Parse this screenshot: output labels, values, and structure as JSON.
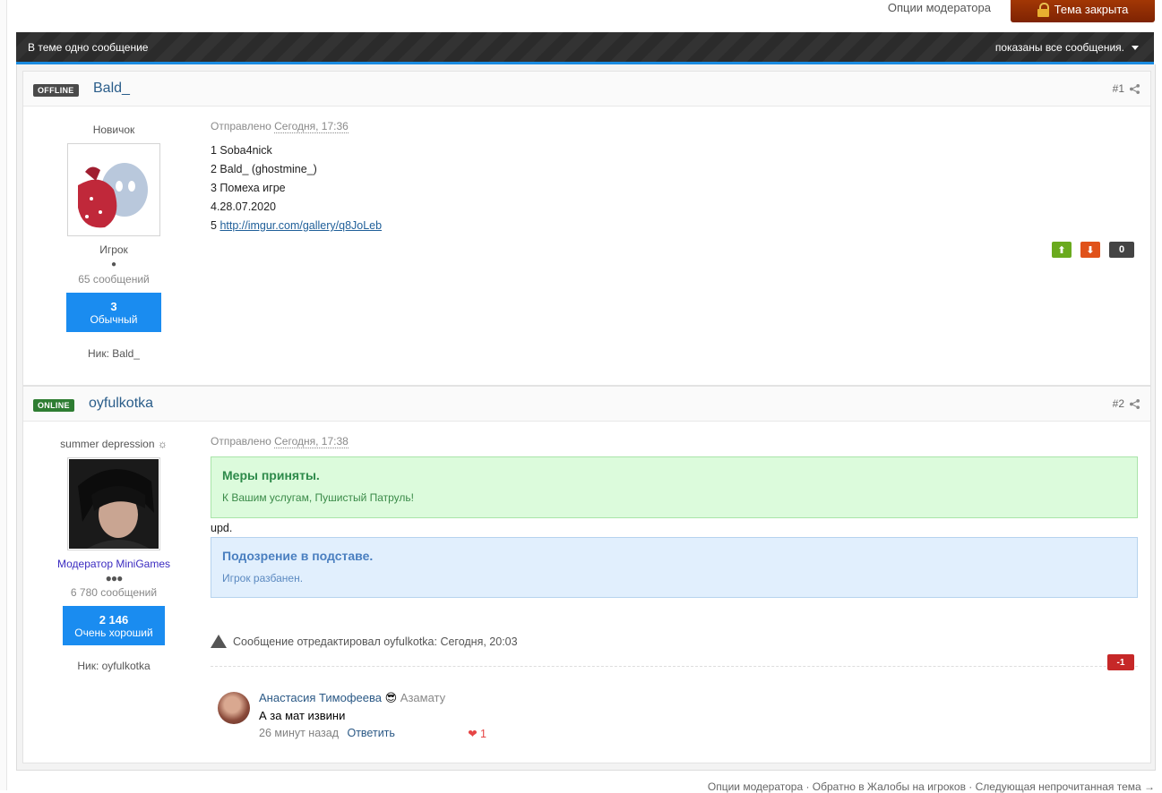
{
  "topbar": {
    "mod_options": "Опции модератора",
    "topic_closed": "Тема закрыта"
  },
  "thread_header": {
    "left": "В теме одно сообщение",
    "right": "показаны все сообщения."
  },
  "posts": [
    {
      "status": "OFFLINE",
      "username": "Bald_",
      "number": "#1",
      "user_title": "Новичок",
      "group": "Игрок",
      "post_count": "65 сообщений",
      "rep_value": "3",
      "rep_label": "Обычный",
      "nick": "Ник: Bald_",
      "sent_prefix": "Отправлено",
      "sent_time": "Сегодня, 17:36",
      "lines": [
        "1 Soba4nick",
        "2 Bald_ (ghostmine_)",
        "3 Помеха игре",
        "4.28.07.2020"
      ],
      "line5_prefix": "5 ",
      "line5_link": "http://imgur.com/gallery/q8JoLeb",
      "vote_count": "0"
    },
    {
      "status": "ONLINE",
      "username": "oyfulkotka",
      "number": "#2",
      "user_title": "summer depression ☼",
      "group": "Модератор MiniGames",
      "post_count": "6 780 сообщений",
      "rep_value": "2 146",
      "rep_label": "Очень хороший",
      "nick": "Ник: oyfulkotka",
      "sent_prefix": "Отправлено",
      "sent_time": "Сегодня, 17:38",
      "green_title": "Меры приняты.",
      "green_sub": "К Вашим услугам, Пушистый Патруль!",
      "upd": "upd.",
      "blue_title": "Подозрение в подставе.",
      "blue_sub": "Игрок разбанен.",
      "edited": "Сообщение отредактировал oyfulkotka: Сегодня, 20:03",
      "vote_count": "-1"
    }
  ],
  "comment": {
    "author": "Анастасия Тимофеева",
    "emoji": "😎",
    "to": "Азамату",
    "text": "А за мат извини",
    "time": "26 минут назад",
    "reply": "Ответить",
    "likes": "1"
  },
  "footer": {
    "links": "Опции модератора · Обратно в Жалобы на игроков · Следующая непрочитанная тема →"
  },
  "colors": {
    "accent": "#1a8be0",
    "rep_box": "#1a8cf0",
    "closed_btn": "#8e2c04"
  }
}
